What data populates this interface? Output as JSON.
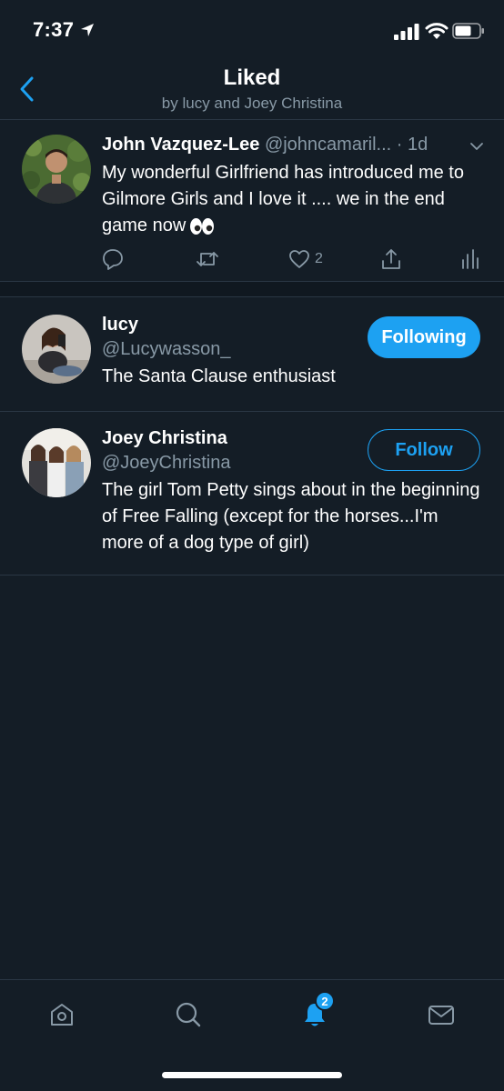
{
  "status_bar": {
    "time": "7:37"
  },
  "header": {
    "title": "Liked",
    "subtitle": "by lucy and Joey Christina"
  },
  "tweet": {
    "name": "John Vazquez-Lee",
    "handle": "@johncamaril...",
    "time": "· 1d",
    "text": "My wonderful Girlfriend has introduced me to Gilmore Girls and I love it .... we in the end game now",
    "like_count": "2"
  },
  "users": [
    {
      "name": "lucy",
      "handle": "@Lucywasson_",
      "bio": "The Santa Clause enthusiast",
      "button": "Following"
    },
    {
      "name": "Joey Christina",
      "handle": "@JoeyChristina",
      "bio": "The girl Tom Petty sings about in the beginning of Free Falling (except for the horses...I'm more of a dog type of girl)",
      "button": "Follow"
    }
  ],
  "tab_bar": {
    "notifications_badge": "2"
  },
  "colors": {
    "background": "#141d26",
    "accent": "#1da1f2",
    "secondary_text": "#8899a6",
    "divider": "#2a3744"
  },
  "icons": [
    "location-arrow-icon",
    "signal-icon",
    "wifi-icon",
    "battery-icon",
    "back-chevron-icon",
    "chevron-down-icon",
    "reply-icon",
    "retweet-icon",
    "heart-icon",
    "share-icon",
    "analytics-icon",
    "home-icon",
    "search-icon",
    "bell-icon",
    "mail-icon"
  ]
}
